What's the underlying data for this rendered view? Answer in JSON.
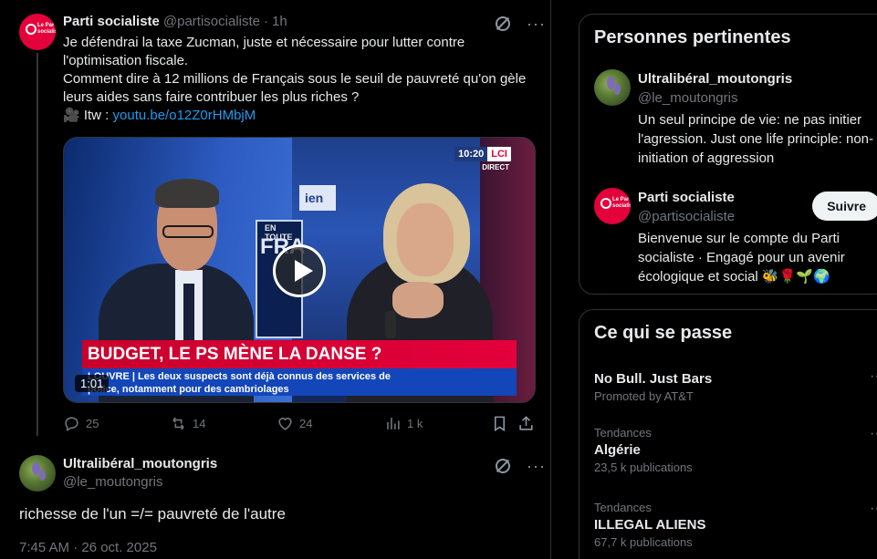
{
  "tweet1": {
    "name": "Parti socialiste",
    "handle": "@partisocialiste",
    "separator": "·",
    "time": "1h",
    "avatar_text": "Le Parti socialiste",
    "line1": "Je défendrai la taxe Zucman, juste et nécessaire pour lutter contre",
    "line2": "l'optimisation fiscale.",
    "line3": "Comment dire à 12 millions de Français sous le seuil de pauvreté qu'on gèle",
    "line4": "leurs aides sans faire contribuer les plus riches ?",
    "itw_prefix": "🎥 Itw : ",
    "link": "youtu.be/o12Z0rHMbjM",
    "video": {
      "clock": "10:20",
      "channel": "LCI",
      "live": "DIRECT",
      "panel_text": "EN TOUTE",
      "panel_big": "FRA",
      "panel_small": "ien",
      "banner": "BUDGET, LE PS MÈNE LA DANSE ?",
      "ticker_prefix": "LOUVRE | ",
      "ticker_line1": "Les deux suspects sont déjà connus des services de",
      "ticker_line2": "police, notamment pour des cambriolages",
      "duration": "1:01"
    },
    "replies": "25",
    "retweets": "14",
    "likes": "24",
    "views": "1 k"
  },
  "tweet2": {
    "name": "Ultralibéral_moutongris",
    "handle": "@le_moutongris",
    "text": "richesse de l'un =/= pauvreté de l'autre",
    "timestamp": "7:45 AM · 26 oct. 2025"
  },
  "relevant": {
    "title": "Personnes pertinentes",
    "people": [
      {
        "name": "Ultralibéral_moutongris",
        "handle": "@le_moutongris",
        "bio_line1": "Un seul principe de vie: ne pas initier",
        "bio_line2": "l'agression. Just one life principle: non-",
        "bio_line3": "initiation of aggression"
      },
      {
        "name": "Parti socialiste",
        "handle": "@partisocialiste",
        "bio_line1": "Bienvenue sur le compte du Parti",
        "bio_line2": "socialiste · Engagé pour un avenir",
        "bio_line3": "écologique et social 🐝🌹🌱🌍",
        "follow_label": "Suivre"
      }
    ]
  },
  "trending": {
    "title": "Ce qui se passe",
    "items": [
      {
        "meta": "",
        "name": "No Bull. Just Bars",
        "sub": "Promoted by AT&T"
      },
      {
        "meta": "Tendances",
        "name": "Algérie",
        "sub": "23,5 k publications"
      },
      {
        "meta": "Tendances",
        "name": "ILLEGAL ALIENS",
        "sub": "67,7 k publications"
      }
    ]
  },
  "colors": {
    "accent_link": "#1d9bf0",
    "ps_red": "#e4003b",
    "muted": "#71767b"
  },
  "icons": [
    "grok-icon",
    "more-icon",
    "reply-icon",
    "retweet-icon",
    "like-icon",
    "views-icon",
    "bookmark-icon",
    "share-icon",
    "play-icon"
  ]
}
